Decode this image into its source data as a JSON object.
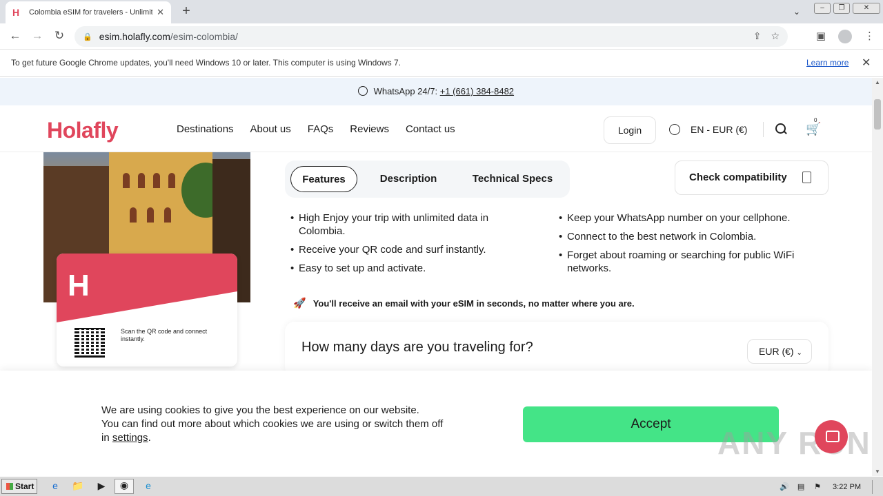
{
  "browser": {
    "tab_title": "Colombia eSIM for travelers - Unlimit",
    "tab_favicon": "H",
    "address": {
      "host": "esim.holafly.com",
      "path": "/esim-colombia/"
    },
    "infobar": {
      "message": "To get future Google Chrome updates, you'll need Windows 10 or later. This computer is using Windows 7.",
      "link": "Learn more"
    }
  },
  "page": {
    "whatsapp": {
      "label": "WhatsApp 24/7:",
      "phone": "+1 (661) 384-8482"
    },
    "header": {
      "logo": "Holafly",
      "nav": [
        "Destinations",
        "About us",
        "FAQs",
        "Reviews",
        "Contact us"
      ],
      "login": "Login",
      "language": "EN - EUR (€)",
      "cart_count": "0"
    },
    "product": {
      "card_logo": "H",
      "scan_text": "Scan the QR code and connect instantly."
    },
    "tabs": [
      "Features",
      "Description",
      "Technical Specs"
    ],
    "check_compat": "Check compatibility",
    "features_left": [
      "High Enjoy your trip with unlimited data in Colombia.",
      "Receive your QR code and surf instantly.",
      "Easy to set up and activate."
    ],
    "features_right": [
      "Keep your WhatsApp number on your cellphone.",
      "Connect to the best network in Colombia.",
      "Forget about roaming or searching for public WiFi networks."
    ],
    "email_note": "You'll receive an email with your eSIM in seconds, no matter where you are.",
    "days_question": "How many days are you traveling for?",
    "currency": "EUR (€)"
  },
  "cookie": {
    "line1": "We are using cookies to give you the best experience on our website.",
    "line2": "You can find out more about which cookies we are using or switch them off",
    "line3_prefix": "in",
    "settings_link": "settings",
    "line3_suffix": ".",
    "accept": "Accept"
  },
  "watermark": "ANY RUN",
  "taskbar": {
    "start": "Start",
    "time": "3:22 PM"
  },
  "colors": {
    "brand": "#e0465c",
    "accept": "#44e487"
  }
}
